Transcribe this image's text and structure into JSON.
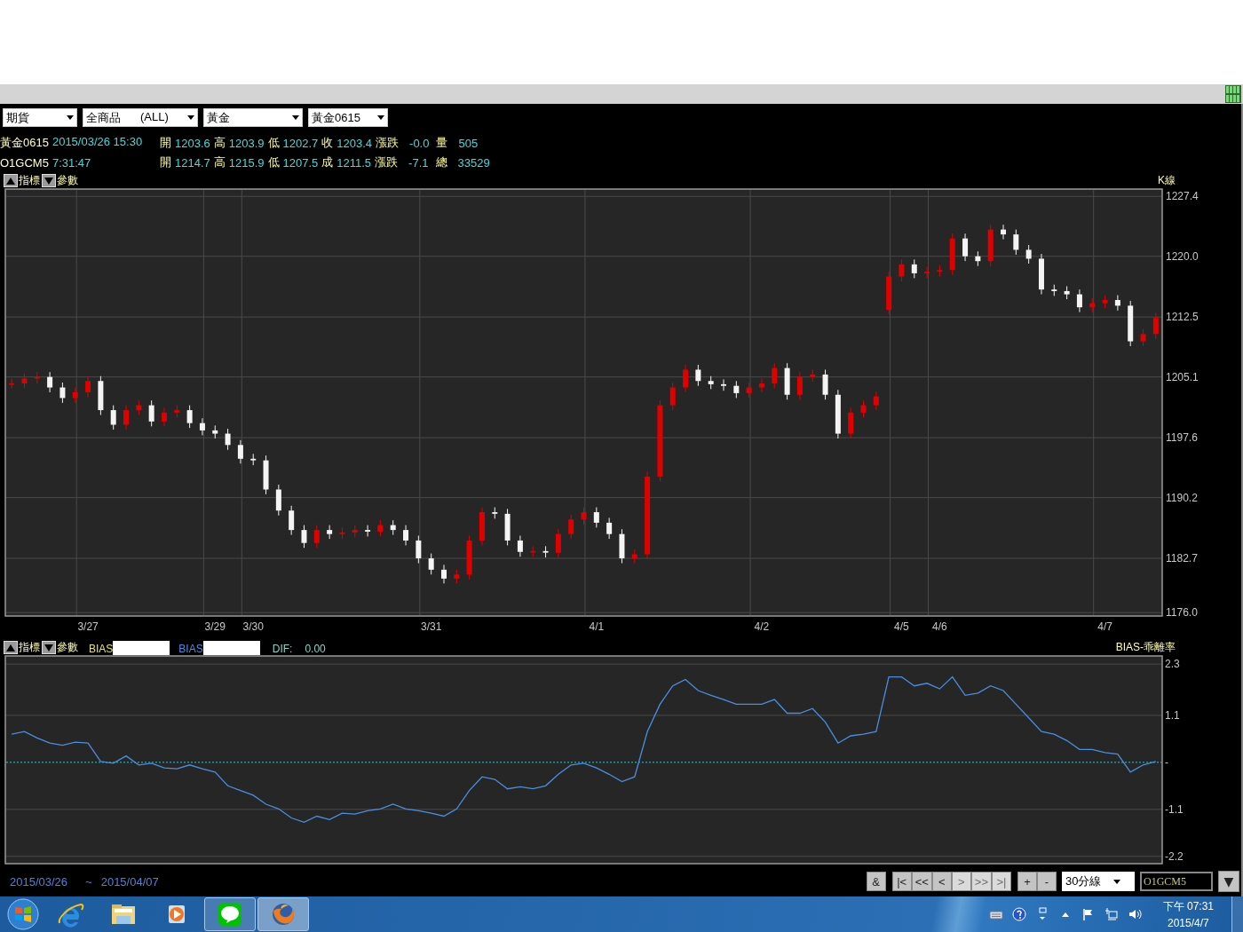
{
  "selectors": [
    {
      "value": "期貨"
    },
    {
      "value": "全商品",
      "suffix": "(ALL)"
    },
    {
      "value": "黃金"
    },
    {
      "value": "黃金0615"
    }
  ],
  "quote_lines": [
    {
      "symbol": "黃金0615",
      "time": "2015/03/26 15:30",
      "fields": [
        {
          "label": "開",
          "value": "1203.6"
        },
        {
          "label": "高",
          "value": "1203.9"
        },
        {
          "label": "低",
          "value": "1202.7"
        },
        {
          "label": "收",
          "value": "1203.4"
        },
        {
          "label": "漲跌",
          "value": "-0.0"
        },
        {
          "label": "量",
          "value": "505"
        }
      ]
    },
    {
      "symbol": "O1GCM5",
      "time": "7:31:47",
      "fields": [
        {
          "label": "開",
          "value": "1214.7"
        },
        {
          "label": "高",
          "value": "1215.9"
        },
        {
          "label": "低",
          "value": "1207.5"
        },
        {
          "label": "成",
          "value": "1211.5"
        },
        {
          "label": "漲跌",
          "value": "-7.1"
        },
        {
          "label": "總",
          "value": "33529"
        }
      ]
    }
  ],
  "panels": [
    {
      "buttons": [
        {
          "label": "指標",
          "kind": "up"
        },
        {
          "label": "參數",
          "kind": "down"
        }
      ],
      "chart_data": {
        "type": "candlestick",
        "grid": true,
        "ylim": [
          1175.8,
          1228.3
        ],
        "categories": [
          null,
          null,
          null,
          null,
          null,
          null,
          "3/27",
          null,
          null,
          null,
          null,
          null,
          null,
          null,
          null,
          null,
          "3/29",
          null,
          null,
          "3/30",
          null,
          null,
          null,
          null,
          null,
          null,
          null,
          null,
          null,
          null,
          null,
          null,
          null,
          "3/31",
          null,
          null,
          null,
          null,
          null,
          null,
          null,
          null,
          null,
          null,
          null,
          null,
          "4/1",
          null,
          null,
          null,
          null,
          null,
          null,
          null,
          null,
          null,
          null,
          null,
          null,
          "4/2",
          null,
          null,
          null,
          null,
          null,
          null,
          null,
          null,
          null,
          null,
          "4/5",
          null,
          null,
          "4/6",
          null,
          null,
          null,
          null,
          null,
          null,
          null,
          null,
          null,
          null,
          null,
          null,
          "4/7",
          null,
          null,
          null,
          null
        ],
        "yticks": [
          {
            "value": 1227.4,
            "label": "1227.4"
          },
          {
            "value": 1220.0,
            "label": "1220.0"
          },
          {
            "value": 1212.5,
            "label": "1212.5"
          },
          {
            "value": 1205.1,
            "label": "1205.1"
          },
          {
            "value": 1197.6,
            "label": "1197.6"
          },
          {
            "value": 1190.2,
            "label": "1190.2"
          },
          {
            "value": 1182.7,
            "label": "1182.7"
          },
          {
            "value": 1176.0,
            "label": "1176.0"
          }
        ],
        "series": [
          {
            "name": "K線",
            "ohlc": [
              [
                1204.3,
                1204.9,
                1203.7,
                1204.3
              ],
              [
                1204.3,
                1205.5,
                1203.7,
                1204.9
              ],
              [
                1204.9,
                1205.7,
                1204.3,
                1205.1
              ],
              [
                1205.1,
                1205.7,
                1203.2,
                1203.8
              ],
              [
                1203.8,
                1204.4,
                1201.9,
                1202.5
              ],
              [
                1202.5,
                1203.8,
                1201.9,
                1203.2
              ],
              [
                1203.2,
                1205.2,
                1202.6,
                1204.6
              ],
              [
                1204.6,
                1205.2,
                1200.4,
                1201.0
              ],
              [
                1201.0,
                1201.6,
                1198.6,
                1199.2
              ],
              [
                1199.2,
                1201.6,
                1198.6,
                1201.0
              ],
              [
                1201.0,
                1202.2,
                1200.4,
                1201.6
              ],
              [
                1201.6,
                1202.2,
                1199.0,
                1199.6
              ],
              [
                1199.6,
                1201.3,
                1199.0,
                1200.7
              ],
              [
                1200.7,
                1201.6,
                1200.1,
                1201.0
              ],
              [
                1201.0,
                1201.6,
                1198.8,
                1199.4
              ],
              [
                1199.4,
                1200.0,
                1197.9,
                1198.5
              ],
              [
                1198.5,
                1199.1,
                1197.5,
                1198.1
              ],
              [
                1198.1,
                1198.7,
                1196.1,
                1196.7
              ],
              [
                1196.7,
                1197.3,
                1194.4,
                1195.0
              ],
              [
                1195.0,
                1195.6,
                1194.2,
                1194.8
              ],
              [
                1194.8,
                1195.4,
                1190.6,
                1191.2
              ],
              [
                1191.2,
                1191.8,
                1188.0,
                1188.6
              ],
              [
                1188.6,
                1189.2,
                1185.6,
                1186.2
              ],
              [
                1186.2,
                1186.8,
                1184.0,
                1184.6
              ],
              [
                1184.6,
                1186.8,
                1184.0,
                1186.2
              ],
              [
                1186.2,
                1186.8,
                1185.1,
                1185.7
              ],
              [
                1185.7,
                1186.5,
                1185.1,
                1185.9
              ],
              [
                1185.9,
                1186.8,
                1185.3,
                1186.2
              ],
              [
                1186.2,
                1186.8,
                1185.4,
                1186.0
              ],
              [
                1186.0,
                1187.4,
                1185.4,
                1186.8
              ],
              [
                1186.8,
                1187.4,
                1185.6,
                1186.2
              ],
              [
                1186.2,
                1186.8,
                1184.3,
                1184.9
              ],
              [
                1184.9,
                1185.5,
                1182.1,
                1182.7
              ],
              [
                1182.7,
                1183.3,
                1180.7,
                1181.3
              ],
              [
                1181.3,
                1181.9,
                1179.6,
                1180.2
              ],
              [
                1180.2,
                1181.3,
                1179.6,
                1180.7
              ],
              [
                1180.7,
                1185.5,
                1180.1,
                1184.9
              ],
              [
                1184.9,
                1189.0,
                1184.3,
                1188.4
              ],
              [
                1188.4,
                1189.0,
                1187.6,
                1188.2
              ],
              [
                1188.2,
                1188.8,
                1184.3,
                1184.9
              ],
              [
                1184.9,
                1185.5,
                1182.9,
                1183.5
              ],
              [
                1183.5,
                1184.2,
                1182.9,
                1183.6
              ],
              [
                1183.6,
                1184.2,
                1182.8,
                1183.4
              ],
              [
                1183.4,
                1186.3,
                1182.8,
                1185.7
              ],
              [
                1185.7,
                1188.1,
                1185.1,
                1187.5
              ],
              [
                1187.5,
                1189.0,
                1186.9,
                1188.4
              ],
              [
                1188.4,
                1189.0,
                1186.5,
                1187.1
              ],
              [
                1187.1,
                1187.7,
                1185.1,
                1185.7
              ],
              [
                1185.7,
                1186.3,
                1182.1,
                1182.7
              ],
              [
                1182.7,
                1183.8,
                1182.1,
                1183.2
              ],
              [
                1183.2,
                1193.4,
                1182.6,
                1192.8
              ],
              [
                1192.8,
                1202.2,
                1192.2,
                1201.6
              ],
              [
                1201.6,
                1204.4,
                1201.0,
                1203.8
              ],
              [
                1203.8,
                1206.6,
                1203.2,
                1206.0
              ],
              [
                1206.0,
                1206.6,
                1204.0,
                1204.6
              ],
              [
                1204.6,
                1205.2,
                1203.6,
                1204.2
              ],
              [
                1204.2,
                1204.8,
                1203.4,
                1204.0
              ],
              [
                1204.0,
                1204.6,
                1202.5,
                1203.1
              ],
              [
                1203.1,
                1204.4,
                1202.5,
                1203.8
              ],
              [
                1203.8,
                1204.9,
                1203.2,
                1204.3
              ],
              [
                1204.3,
                1206.8,
                1203.7,
                1206.2
              ],
              [
                1206.2,
                1206.8,
                1202.3,
                1202.9
              ],
              [
                1202.9,
                1205.7,
                1202.3,
                1205.1
              ],
              [
                1205.1,
                1206.0,
                1204.5,
                1205.4
              ],
              [
                1205.4,
                1206.0,
                1202.3,
                1202.9
              ],
              [
                1202.9,
                1203.5,
                1197.5,
                1198.1
              ],
              [
                1198.1,
                1201.3,
                1197.5,
                1200.7
              ],
              [
                1200.7,
                1202.2,
                1200.1,
                1201.6
              ],
              [
                1201.6,
                1203.3,
                1201.0,
                1202.7
              ],
              [
                1213.4,
                1218.1,
                1212.8,
                1217.5
              ],
              [
                1217.5,
                1219.6,
                1216.9,
                1219.0
              ],
              [
                1219.0,
                1219.6,
                1217.3,
                1217.9
              ],
              [
                1217.9,
                1218.7,
                1217.3,
                1218.1
              ],
              [
                1218.1,
                1218.9,
                1217.5,
                1218.3
              ],
              [
                1218.3,
                1222.8,
                1217.7,
                1222.2
              ],
              [
                1222.2,
                1222.8,
                1219.4,
                1220.0
              ],
              [
                1220.0,
                1220.6,
                1218.8,
                1219.4
              ],
              [
                1219.4,
                1223.9,
                1218.8,
                1223.3
              ],
              [
                1223.3,
                1223.9,
                1222.1,
                1222.7
              ],
              [
                1222.7,
                1223.3,
                1220.2,
                1220.8
              ],
              [
                1220.8,
                1221.4,
                1219.1,
                1219.7
              ],
              [
                1219.7,
                1220.3,
                1215.3,
                1215.9
              ],
              [
                1215.9,
                1216.5,
                1215.1,
                1215.7
              ],
              [
                1215.7,
                1216.3,
                1214.7,
                1215.3
              ],
              [
                1215.3,
                1215.9,
                1213.1,
                1213.7
              ],
              [
                1213.7,
                1214.8,
                1213.1,
                1214.2
              ],
              [
                1214.2,
                1215.2,
                1213.6,
                1214.6
              ],
              [
                1214.6,
                1215.2,
                1213.3,
                1213.9
              ],
              [
                1213.9,
                1214.5,
                1208.9,
                1209.5
              ],
              [
                1209.5,
                1211.0,
                1208.9,
                1210.4
              ],
              [
                1210.4,
                1213.0,
                1209.8,
                1212.4
              ]
            ]
          }
        ]
      }
    },
    {
      "buttons": [
        {
          "label": "指標",
          "kind": "up"
        },
        {
          "label": "參數",
          "kind": "down"
        }
      ],
      "title": "BIAS-乖離率",
      "legend": [
        {
          "kind": "label",
          "text": "BIAS",
          "masked": true
        },
        {
          "kind": "series",
          "masked": true
        },
        {
          "kind": "value",
          "text": "DIF:",
          "value": "0.00"
        }
      ],
      "chart_data": {
        "type": "line",
        "grid": true,
        "ylim": [
          -2.35,
          2.49
        ],
        "categories": [
          null,
          null,
          null,
          null,
          null,
          null,
          null,
          null,
          null,
          null,
          null,
          null,
          null,
          null,
          null,
          null,
          null,
          null,
          null,
          null,
          null,
          null,
          null,
          null,
          null,
          null,
          null,
          null,
          null,
          null,
          null,
          null,
          null,
          null,
          null,
          null,
          null,
          null,
          null,
          null,
          null,
          null,
          null,
          null,
          null,
          null,
          null,
          null,
          null,
          null,
          null,
          null,
          null,
          null,
          null,
          null,
          null,
          null,
          null,
          null,
          null,
          null,
          null,
          null,
          null,
          null,
          null,
          null,
          null,
          null,
          null,
          null,
          null,
          null,
          null,
          null,
          null,
          null,
          null,
          null,
          null,
          null,
          null,
          null,
          null,
          null,
          null,
          null,
          null,
          null,
          null
        ],
        "yticks": [
          {
            "value": 2.3,
            "label": "2.3"
          },
          {
            "value": 1.1,
            "label": "1.1"
          },
          {
            "value": 0,
            "label": "-"
          },
          {
            "value": -1.1,
            "label": "-1.1"
          },
          {
            "value": -2.2,
            "label": "-2.2"
          }
        ],
        "ref_lines": [
          {
            "axis": "y",
            "value": 0,
            "color": "#30c8c8"
          }
        ],
        "series": [
          {
            "name": "BIAS",
            "color": "#4a8ee2",
            "values": [
              0.66,
              0.72,
              0.57,
              0.45,
              0.4,
              0.47,
              0.45,
              0.02,
              -0.02,
              0.15,
              -0.06,
              -0.02,
              -0.13,
              -0.15,
              -0.06,
              -0.15,
              -0.23,
              -0.55,
              -0.66,
              -0.77,
              -0.98,
              -1.09,
              -1.3,
              -1.4,
              -1.26,
              -1.34,
              -1.19,
              -1.21,
              -1.13,
              -1.09,
              -0.98,
              -1.09,
              -1.13,
              -1.19,
              -1.26,
              -1.09,
              -0.66,
              -0.34,
              -0.4,
              -0.62,
              -0.57,
              -0.62,
              -0.55,
              -0.28,
              -0.06,
              -0.02,
              -0.13,
              -0.28,
              -0.45,
              -0.34,
              0.72,
              1.36,
              1.79,
              1.94,
              1.68,
              1.57,
              1.47,
              1.36,
              1.36,
              1.36,
              1.47,
              1.15,
              1.15,
              1.26,
              0.94,
              0.45,
              0.62,
              0.66,
              0.72,
              2.0,
              2.0,
              1.79,
              1.85,
              1.72,
              2.0,
              1.57,
              1.62,
              1.79,
              1.68,
              1.36,
              1.04,
              0.72,
              0.66,
              0.51,
              0.3,
              0.3,
              0.23,
              0.19,
              -0.23,
              -0.06,
              0.02
            ]
          }
        ]
      }
    }
  ],
  "bottom_bar": {
    "range_from": "2015/03/26",
    "range_sep": "~",
    "range_to": "2015/04/07",
    "button_groups": [
      [
        {
          "label": "&",
          "disabled": false
        }
      ],
      [
        {
          "label": "|<",
          "disabled": false
        },
        {
          "label": "<<",
          "disabled": false
        },
        {
          "label": "<",
          "disabled": false
        },
        {
          "label": ">",
          "disabled": true
        },
        {
          "label": ">>",
          "disabled": true
        },
        {
          "label": ">|",
          "disabled": true
        }
      ],
      [
        {
          "label": "+",
          "disabled": false
        },
        {
          "label": "-",
          "disabled": false
        }
      ]
    ],
    "period_select": {
      "value": "30分線"
    },
    "symbol_field": {
      "value": "O1GCM5"
    },
    "menu_button": "▼"
  },
  "taskbar": {
    "apps": [
      {
        "kind": "ie",
        "running": false,
        "selected": false
      },
      {
        "kind": "folder",
        "running": false,
        "selected": false
      },
      {
        "kind": "media",
        "running": false,
        "selected": false
      },
      {
        "kind": "line",
        "running": true,
        "selected": false
      },
      {
        "kind": "firefox",
        "running": true,
        "selected": true
      }
    ],
    "clock": {
      "time": "下午 07:31",
      "date": "2015/4/7"
    }
  }
}
